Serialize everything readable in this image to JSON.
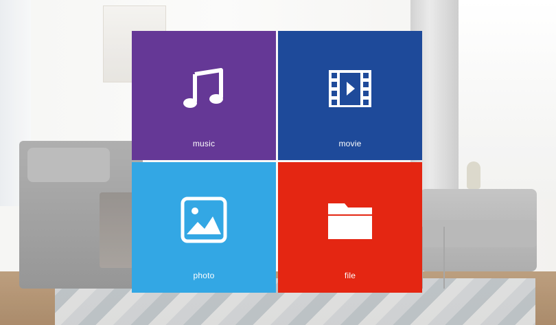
{
  "tiles": [
    {
      "label": "music",
      "icon": "music-note-icon",
      "color": "#653896"
    },
    {
      "label": "movie",
      "icon": "film-icon",
      "color": "#1e4a9a"
    },
    {
      "label": "photo",
      "icon": "image-icon",
      "color": "#33a7e4"
    },
    {
      "label": "file",
      "icon": "folder-icon",
      "color": "#e42612"
    }
  ]
}
